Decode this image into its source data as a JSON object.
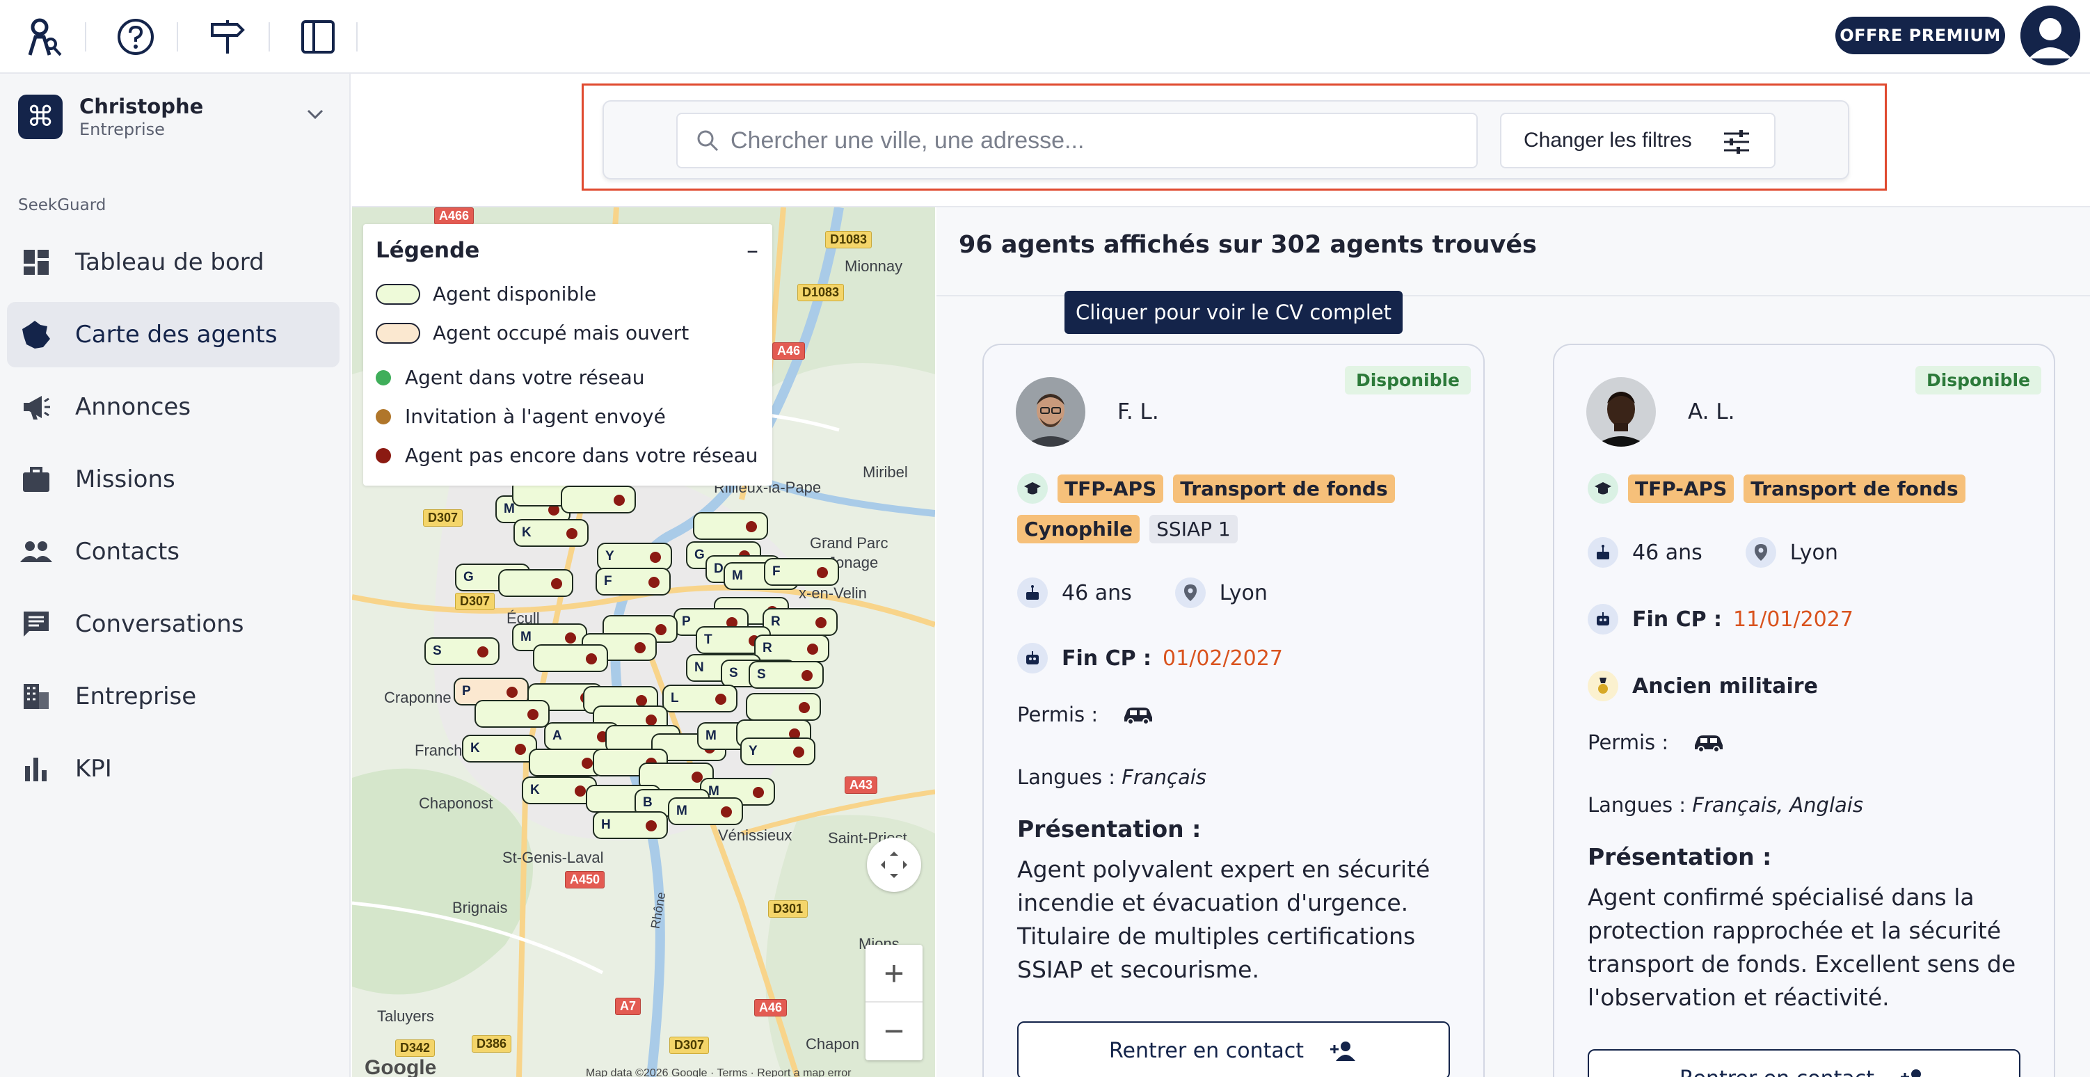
{
  "topbar": {
    "icons": [
      "agent-key-logo-icon",
      "help-icon",
      "signpost-icon",
      "sidebar-toggle-icon"
    ],
    "premium_label": "OFFRE PREMIUM"
  },
  "org": {
    "name": "Christophe",
    "type": "Entreprise"
  },
  "sidebar": {
    "section_label": "SeekGuard",
    "items": [
      {
        "label": "Tableau de bord",
        "icon": "dashboard-icon"
      },
      {
        "label": "Carte des agents",
        "icon": "map-france-icon",
        "active": true
      },
      {
        "label": "Annonces",
        "icon": "megaphone-icon"
      },
      {
        "label": "Missions",
        "icon": "briefcase-icon"
      },
      {
        "label": "Contacts",
        "icon": "people-icon"
      },
      {
        "label": "Conversations",
        "icon": "chat-icon"
      },
      {
        "label": "Entreprise",
        "icon": "building-icon"
      },
      {
        "label": "KPI",
        "icon": "bar-chart-icon"
      }
    ]
  },
  "search": {
    "placeholder": "Chercher une ville, une adresse...",
    "filters_label": "Changer les filtres"
  },
  "legend": {
    "title": "Légende",
    "collapse": "–",
    "items": [
      {
        "label": "Agent disponible",
        "color": "#eefad9"
      },
      {
        "label": "Agent occupé mais ouvert",
        "color": "#fbe8d0"
      },
      {
        "label": "Agent dans votre réseau",
        "color": "#3fae5a"
      },
      {
        "label": "Invitation à l'agent envoyé",
        "color": "#b0762a"
      },
      {
        "label": "Agent pas encore dans votre réseau",
        "color": "#8b1a12"
      }
    ]
  },
  "map": {
    "places": [
      "Mionnay",
      "Rillieux-la-Pape",
      "Miribel",
      "Grand Parc",
      "Jonage",
      "x-en-Velin",
      "Écull",
      "Craponne",
      "Franch",
      "Chaponost",
      "St-Genis-Laval",
      "Brignais",
      "Vénissieux",
      "Saint-Priest",
      "Rhône",
      "Mions",
      "Taluyers",
      "Chapon"
    ],
    "roads": [
      "A466",
      "D1083",
      "D1083",
      "A46",
      "D307",
      "D307",
      "A43",
      "A450",
      "D301",
      "A7",
      "A46",
      "D342",
      "D386",
      "D307"
    ],
    "markers": [
      "M",
      "K",
      "Y",
      "G",
      "M",
      "F",
      "G",
      "F",
      "M",
      "P",
      "R",
      "S",
      "T",
      "R",
      "D",
      "S",
      "S",
      "P",
      "L",
      "M",
      "N",
      "A",
      "K",
      "M",
      "Y",
      "K",
      "B",
      "M",
      "H",
      "M"
    ],
    "attribution": "Map data ©2026 Google · Terms · Report a map error",
    "google": "Google",
    "zoom_in": "+",
    "zoom_out": "−"
  },
  "results": {
    "count_text": "96 agents affichés sur 302 agents trouvés",
    "tooltip": "Cliquer pour voir le CV complet",
    "cards": [
      {
        "name": "F. L.",
        "status": "Disponible",
        "tags": [
          "TFP-APS",
          "Transport de fonds",
          "Cynophile",
          "SSIAP 1"
        ],
        "age": "46 ans",
        "city": "Lyon",
        "fincp_label": "Fin CP :",
        "fincp_date": "01/02/2027",
        "permis_label": "Permis :",
        "langues_label": "Langues :",
        "langues": "Français",
        "pres_title": "Présentation :",
        "pres_text": "Agent polyvalent expert en sécurité incendie et évacuation d'urgence. Titulaire de multiples certifications SSIAP et secourisme.",
        "contact_label": "Rentrer en contact"
      },
      {
        "name": "A. L.",
        "status": "Disponible",
        "tags": [
          "TFP-APS",
          "Transport de fonds"
        ],
        "age": "46 ans",
        "city": "Lyon",
        "fincp_label": "Fin CP :",
        "fincp_date": "11/01/2027",
        "extra": "Ancien militaire",
        "permis_label": "Permis :",
        "langues_label": "Langues :",
        "langues": "Français, Anglais",
        "pres_title": "Présentation :",
        "pres_text": "Agent confirmé spécialisé dans la protection rapprochée et la sécurité transport de fonds. Excellent sens de l'observation et réactivité.",
        "contact_label": "Rentrer en contact"
      }
    ]
  }
}
